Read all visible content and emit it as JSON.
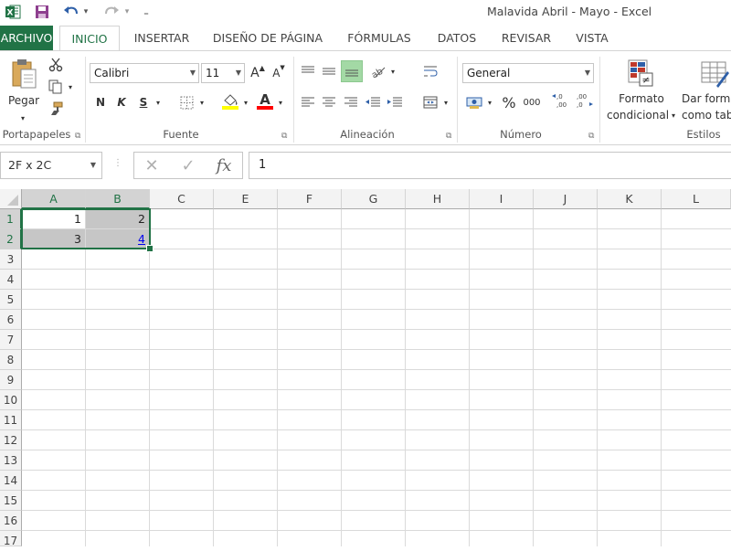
{
  "window": {
    "title": "Malavida Abril - Mayo - Excel"
  },
  "qat": {
    "undo_dropdown": "▾",
    "redo_dropdown": "▾",
    "customize": "₌"
  },
  "tabs": [
    {
      "label": "ARCHIVO"
    },
    {
      "label": "INICIO"
    },
    {
      "label": "INSERTAR"
    },
    {
      "label": "DISEÑO DE PÁGINA"
    },
    {
      "label": "FÓRMULAS"
    },
    {
      "label": "DATOS"
    },
    {
      "label": "REVISAR"
    },
    {
      "label": "VISTA"
    }
  ],
  "ribbon": {
    "clipboard": {
      "paste_label": "Pegar",
      "group_label": "Portapapeles"
    },
    "font": {
      "font_name": "Calibri",
      "font_size": "11",
      "grow_label": "A",
      "shrink_label": "A",
      "bold": "N",
      "italic": "K",
      "underline": "S",
      "font_color_letter": "A",
      "group_label": "Fuente",
      "highlight_color": "#ffff00",
      "font_color": "#ff0000"
    },
    "alignment": {
      "group_label": "Alineación"
    },
    "number": {
      "format": "General",
      "percent": "%",
      "thousands": "000",
      "increase_decimal": "←,0 ,00",
      "decrease_decimal": ",00 →,0",
      "group_label": "Número"
    },
    "styles": {
      "conditional_line1": "Formato",
      "conditional_line2": "condicional",
      "table_line1": "Dar forma",
      "table_line2": "como tabla",
      "group_label": "Estilos"
    }
  },
  "formula_bar": {
    "name_box": "2F x 2C",
    "cancel": "✕",
    "enter": "✓",
    "fx": "fx",
    "value": "1"
  },
  "sheet": {
    "columns": [
      "A",
      "B",
      "C",
      "E",
      "F",
      "G",
      "H",
      "I",
      "J",
      "K",
      "L"
    ],
    "rows": [
      "1",
      "2",
      "3",
      "4",
      "5",
      "6",
      "7",
      "8",
      "9",
      "10",
      "11",
      "12",
      "13",
      "14",
      "15",
      "16",
      "17"
    ],
    "cells": {
      "A1": "1",
      "B1": "2",
      "A2": "3",
      "B2": "4"
    }
  },
  "colors": {
    "accent": "#217346",
    "selection_fill": "#c6c6c6",
    "grid_line": "#dadada",
    "header_bg": "#f3f3f3",
    "hyperlink": "#0000ee"
  }
}
